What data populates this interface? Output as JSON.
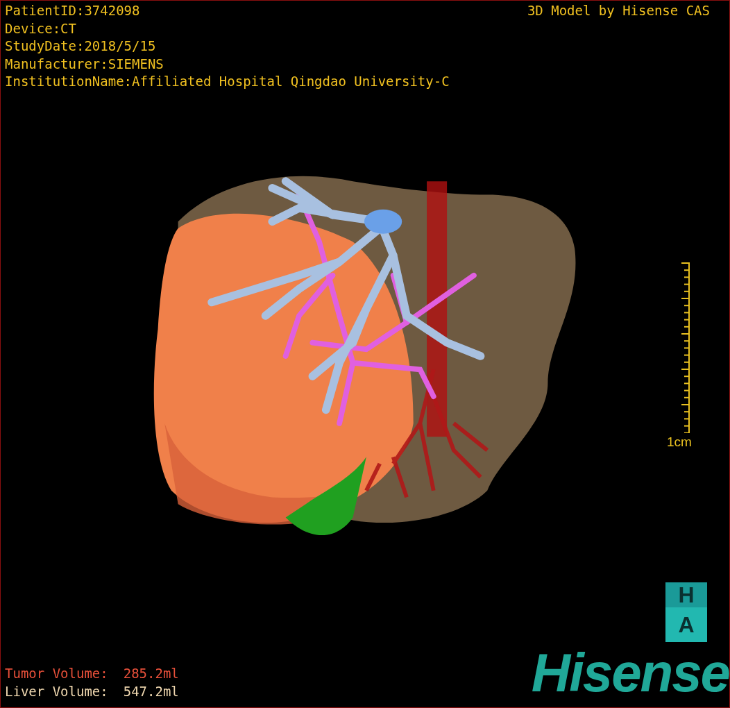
{
  "patient_info": [
    "PatientID:3742098",
    "Device:CT",
    "StudyDate:2018/5/15",
    "Manufacturer:SIEMENS",
    "InstitutionName:Affiliated Hospital Qingdao University-C"
  ],
  "title": "3D Model by Hisense CAS",
  "scale_bar": {
    "label": "1cm"
  },
  "volumes": [
    {
      "kind": "tumor",
      "label": "Tumor Volume:",
      "value": "285.2ml"
    },
    {
      "kind": "liver",
      "label": "Liver Volume:",
      "value": "547.2ml"
    }
  ],
  "orientation_cube": {
    "top": "H",
    "front": "A"
  },
  "logo": "Hisense"
}
